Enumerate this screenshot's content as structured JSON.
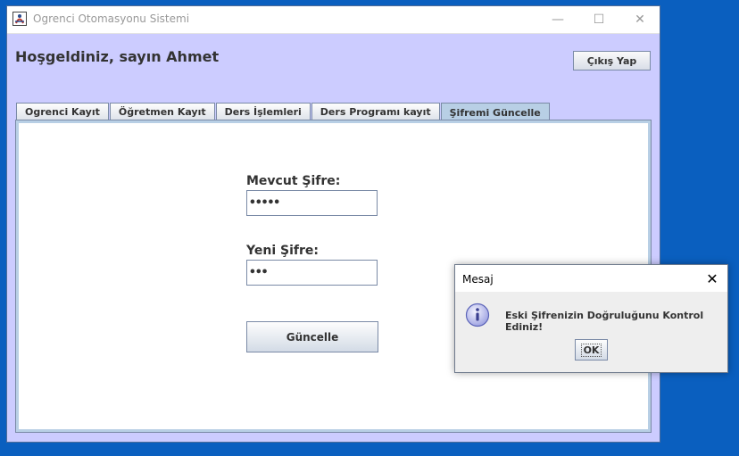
{
  "window": {
    "title": "Ogrenci Otomasyonu Sistemi",
    "icon": "java-app-icon",
    "minimize_symbol": "—",
    "maximize_symbol": "☐",
    "close_symbol": "✕"
  },
  "header": {
    "welcome": "Hoşgeldiniz, sayın Ahmet",
    "logout_label": "Çıkış Yap"
  },
  "tabs": [
    {
      "label": "Ogrenci Kayıt",
      "active": false
    },
    {
      "label": "Öğretmen Kayıt",
      "active": false
    },
    {
      "label": "Ders İşlemleri",
      "active": false
    },
    {
      "label": "Ders Programı kayıt",
      "active": false
    },
    {
      "label": "Şifremi Güncelle",
      "active": true
    }
  ],
  "form": {
    "current_password_label": "Mevcut Şifre:",
    "current_password_value": "•••••",
    "new_password_label": "Yeni Şifre:",
    "new_password_value": "•••",
    "update_button": "Güncelle"
  },
  "dialog": {
    "title": "Mesaj",
    "close_symbol": "✕",
    "icon": "info-icon",
    "message": "Eski Şifrenizin Doğruluğunu Kontrol Ediniz!",
    "ok_label": "OK"
  },
  "colors": {
    "desktop": "#0a5fbf",
    "window_bg": "#ccccff",
    "selected_tab": "#b8cfe5",
    "border": "#7a8aa6"
  }
}
